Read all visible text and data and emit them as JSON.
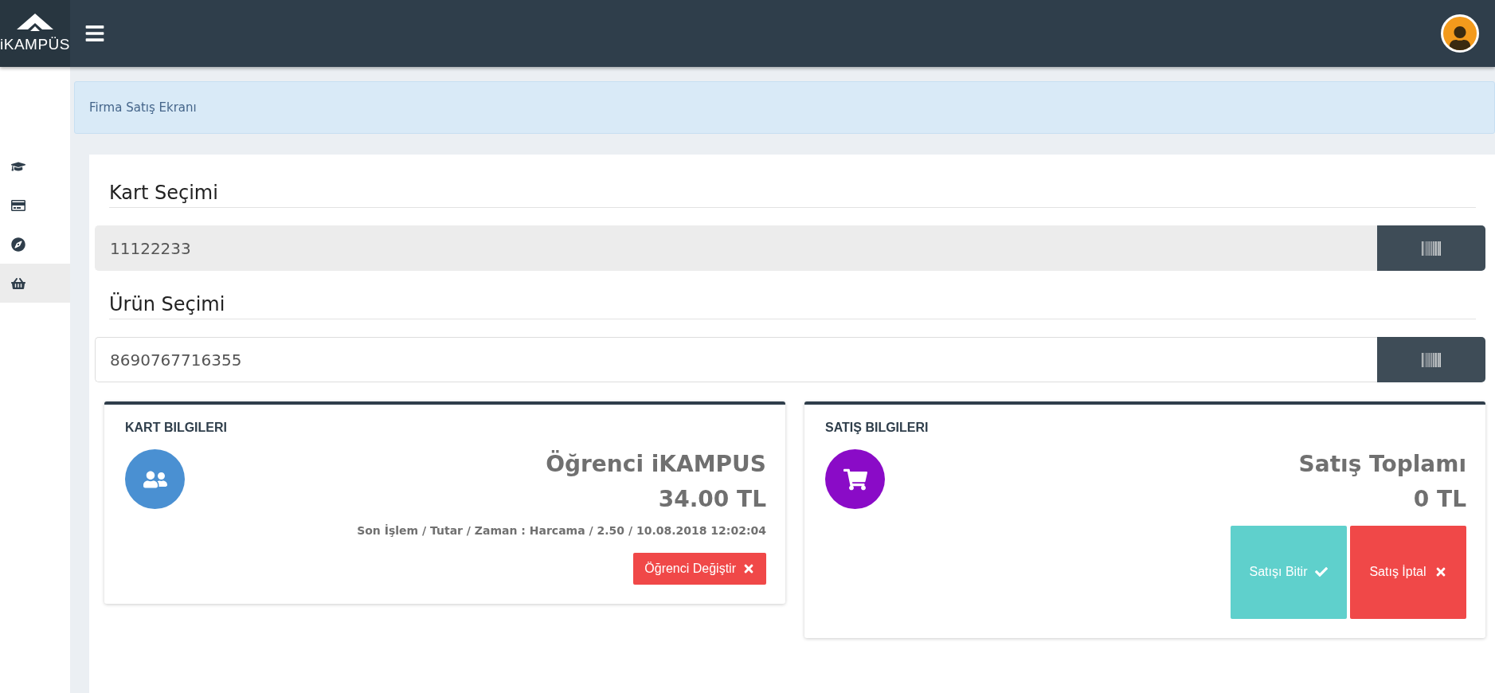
{
  "header": {
    "logo": "iKAMPÜS"
  },
  "sidebar": {
    "items": [
      {
        "kind": "graduation",
        "selected": false
      },
      {
        "kind": "card",
        "selected": false
      },
      {
        "kind": "compass",
        "selected": false
      },
      {
        "kind": "basket",
        "selected": true
      }
    ]
  },
  "breadcrumb": "Firma Satış Ekranı",
  "card_selection": {
    "title": "Kart Seçimi",
    "value": "11122233",
    "disabled": true
  },
  "product_selection": {
    "title": "Ürün Seçimi",
    "value": "8690767716355",
    "disabled": false
  },
  "card_info": {
    "title": "KART BILGILERI",
    "name": "Öğrenci iKAMPUS",
    "balance": "34.00 TL",
    "last_transaction": "Son İşlem / Tutar / Zaman : Harcama / 2.50 / 10.08.2018 12:02:04",
    "button": "Öğrenci Değiştir",
    "color": "#4a90d2"
  },
  "sale_info": {
    "title": "SATIŞ BILGILERI",
    "total_label": "Satış Toplamı",
    "total": "0 TL",
    "color": "#8a0bc7",
    "buttons": [
      {
        "label": "Satışı Bitir",
        "kind": "finish"
      },
      {
        "label": "Satış İptal",
        "kind": "cancel"
      }
    ]
  }
}
